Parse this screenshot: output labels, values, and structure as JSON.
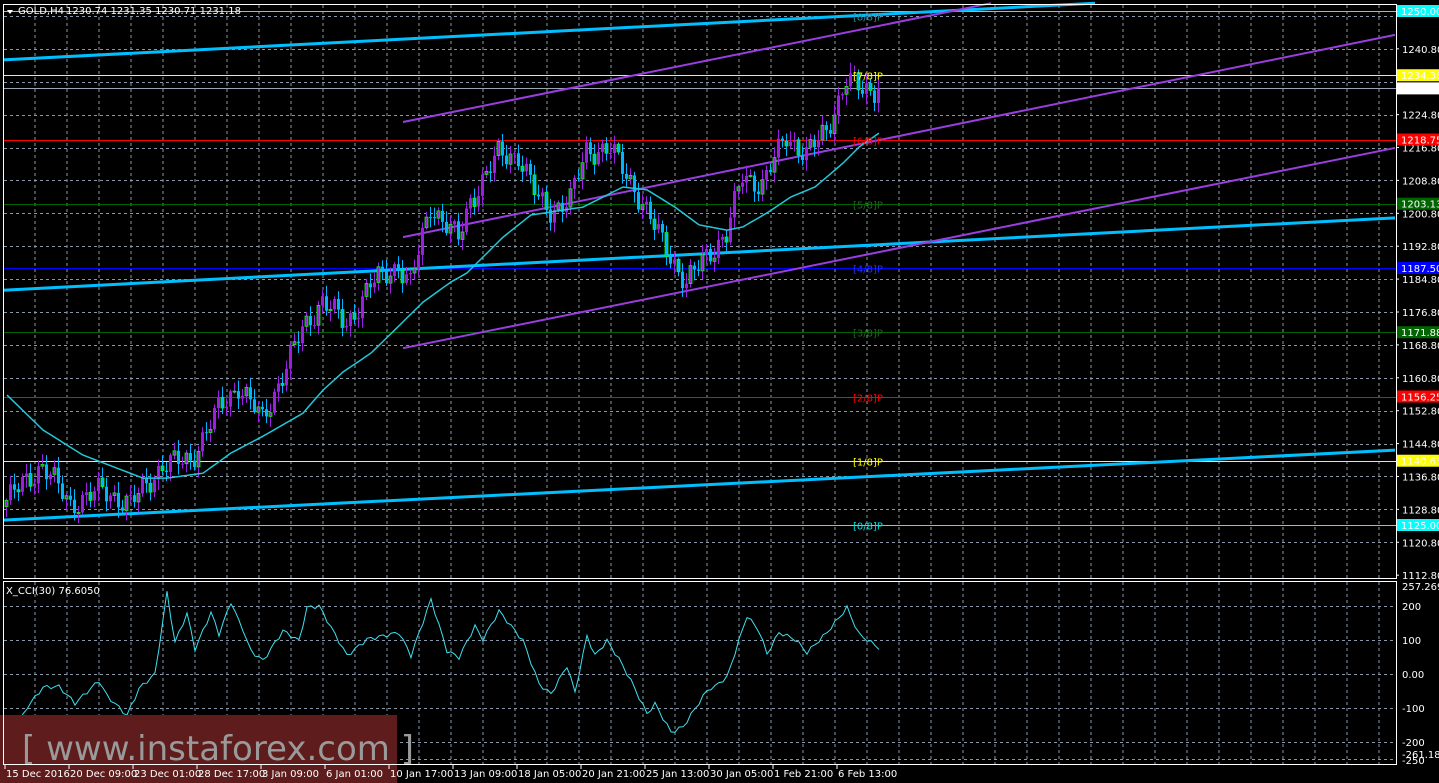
{
  "header": {
    "symbol": "GOLD,H4",
    "ohlc": "1230.74 1231.35 1230.71 1231.18"
  },
  "indicator": {
    "label": "X_CCI(30) 76.6050"
  },
  "watermark": {
    "text": "[ www.instaforex.com ]"
  },
  "colors": {
    "bull": "#9b1fe0",
    "bear": "#00b4ff",
    "bear_edge": "#00ff00",
    "ma": "#22c8d8",
    "cci": "#3de0f0",
    "trend": "#00bfff",
    "channel": "#9a3ee0"
  },
  "chart_data": {
    "type": "candlestick",
    "title": "GOLD,H4",
    "ylim": [
      1112.8,
      1252.5
    ],
    "x_tick_labels": [
      "15 Dec 2016",
      "20 Dec 09:00",
      "23 Dec 01:00",
      "28 Dec 17:00",
      "3 Jan 09:00",
      "6 Jan 01:00",
      "10 Jan 17:00",
      "13 Jan 09:00",
      "18 Jan 05:00",
      "20 Jan 21:00",
      "25 Jan 13:00",
      "30 Jan 05:00",
      "1 Feb 21:00",
      "6 Feb 13:00"
    ],
    "bars_per_x_tick": 16,
    "y_tick_labels": [
      "1240.80",
      "1224.80",
      "1216.80",
      "1208.80",
      "1200.80",
      "1192.80",
      "1184.80",
      "1176.80",
      "1168.80",
      "1160.80",
      "1152.80",
      "1144.80",
      "1136.80",
      "1128.80",
      "1120.80",
      "1112.80"
    ],
    "close_anchors": [
      [
        0,
        1131
      ],
      [
        9,
        1139.6
      ],
      [
        16,
        1130
      ],
      [
        24,
        1133.5
      ],
      [
        31,
        1130
      ],
      [
        39,
        1139.6
      ],
      [
        46,
        1140.8
      ],
      [
        53,
        1153
      ],
      [
        58,
        1159
      ],
      [
        64,
        1150.5
      ],
      [
        69,
        1161.5
      ],
      [
        74,
        1172.4
      ],
      [
        79,
        1179.7
      ],
      [
        85,
        1173.6
      ],
      [
        91,
        1183.4
      ],
      [
        98,
        1188.2
      ],
      [
        101,
        1183.4
      ],
      [
        106,
        1202.8
      ],
      [
        113,
        1194.3
      ],
      [
        116,
        1204
      ],
      [
        123,
        1215
      ],
      [
        128,
        1215
      ],
      [
        133,
        1204
      ],
      [
        136,
        1201.6
      ],
      [
        141,
        1204
      ],
      [
        145,
        1216.2
      ],
      [
        151,
        1216.2
      ],
      [
        156,
        1208.9
      ],
      [
        161,
        1199.2
      ],
      [
        166,
        1190.7
      ],
      [
        170,
        1183.4
      ],
      [
        175,
        1190.7
      ],
      [
        180,
        1195.5
      ],
      [
        184,
        1210
      ],
      [
        189,
        1207.7
      ],
      [
        195,
        1219.8
      ],
      [
        200,
        1215
      ],
      [
        205,
        1221
      ],
      [
        210,
        1233.2
      ],
      [
        214,
        1230.8
      ],
      [
        218,
        1231.18
      ]
    ],
    "ma_anchors": [
      [
        0,
        1156.6
      ],
      [
        9,
        1148.1
      ],
      [
        19,
        1142.0
      ],
      [
        34,
        1136.4
      ],
      [
        40,
        1136.4
      ],
      [
        49,
        1137.6
      ],
      [
        56,
        1142.5
      ],
      [
        64,
        1146.6
      ],
      [
        74,
        1152.2
      ],
      [
        79,
        1157.8
      ],
      [
        84,
        1162.2
      ],
      [
        91,
        1166.8
      ],
      [
        99,
        1174.4
      ],
      [
        104,
        1179.2
      ],
      [
        111,
        1184.1
      ],
      [
        115,
        1186.3
      ],
      [
        124,
        1195.0
      ],
      [
        131,
        1200.4
      ],
      [
        144,
        1202.3
      ],
      [
        154,
        1207.2
      ],
      [
        160,
        1206.5
      ],
      [
        167,
        1202.3
      ],
      [
        173,
        1198.0
      ],
      [
        180,
        1196.7
      ],
      [
        184,
        1197.5
      ],
      [
        190,
        1200.9
      ],
      [
        196,
        1204.8
      ],
      [
        202,
        1207.2
      ],
      [
        209,
        1213.0
      ],
      [
        213,
        1216.9
      ],
      [
        218,
        1220.3
      ]
    ],
    "murrey_levels": [
      {
        "label": "[8/8]P",
        "price": 1250.0,
        "price_text": "1250.00",
        "color": "#00ffff",
        "text_color": "#2a8fa0"
      },
      {
        "label": "[7/8]P",
        "price": 1234.38,
        "price_text": "1234.38",
        "color": "#ffff00",
        "text_color": "#ffff00"
      },
      {
        "label": "[6/8]P",
        "price": 1218.75,
        "price_text": "1218.75",
        "color": "#ff0000",
        "text_color": "#ff0000"
      },
      {
        "label": "[5/8]P",
        "price": 1203.13,
        "price_text": "1203.13",
        "color": "#006400",
        "text_color": "#1a6a1a"
      },
      {
        "label": "[4/8]P",
        "price": 1187.5,
        "price_text": "1187.50",
        "color": "#0000ff",
        "text_color": "#2030ff"
      },
      {
        "label": "[3/8]P",
        "price": 1171.88,
        "price_text": "1171.88",
        "color": "#006400",
        "text_color": "#1a6a1a"
      },
      {
        "label": "[2/8]P",
        "price": 1156.25,
        "price_text": "1156.25",
        "color": "#ff0000",
        "text_color": "#ff0000"
      },
      {
        "label": "[1/8]P",
        "price": 1140.63,
        "price_text": "1140.63",
        "color": "#ffff00",
        "text_color": "#ffff00"
      },
      {
        "label": "[0/8]P",
        "price": 1125.0,
        "price_text": "1125.00",
        "color": "#00ffff",
        "text_color": "#00e0e0"
      }
    ],
    "current_price": {
      "price": 1231.18,
      "price_text": "1231.18"
    },
    "trendlines": [
      {
        "kind": "trend",
        "from": [
          -1,
          1238.1
        ],
        "to": [
          272,
          1251.9
        ]
      },
      {
        "kind": "trend",
        "from": [
          -1,
          1182.1
        ],
        "to": [
          347,
          1199.7
        ]
      },
      {
        "kind": "trend",
        "from": [
          -1,
          1126.2
        ],
        "to": [
          347,
          1143.2
        ]
      },
      {
        "kind": "channel",
        "from": [
          99,
          1223.0
        ],
        "to": [
          246,
          1251.9
        ]
      },
      {
        "kind": "channel",
        "from": [
          99,
          1195.0
        ],
        "to": [
          347,
          1244.2
        ]
      },
      {
        "kind": "channel",
        "from": [
          99,
          1168.0
        ],
        "to": [
          347,
          1216.7
        ]
      }
    ],
    "cci": {
      "period": 30,
      "y_tick_labels": [
        "257.2693",
        "200",
        "100",
        "0.00",
        "-100",
        "-200",
        "-261.1837",
        "-250"
      ],
      "ylim": [
        -261.1837,
        257.2693
      ],
      "anchors": [
        [
          0,
          -219
        ],
        [
          5,
          -98
        ],
        [
          9,
          -39
        ],
        [
          13,
          -37
        ],
        [
          17,
          -86
        ],
        [
          23,
          -20
        ],
        [
          25,
          -64
        ],
        [
          30,
          -122
        ],
        [
          33,
          -43
        ],
        [
          37,
          0
        ],
        [
          40,
          239
        ],
        [
          42,
          93
        ],
        [
          45,
          178
        ],
        [
          47,
          73
        ],
        [
          51,
          181
        ],
        [
          53,
          117
        ],
        [
          56,
          212
        ],
        [
          61,
          68
        ],
        [
          64,
          39
        ],
        [
          69,
          127
        ],
        [
          73,
          98
        ],
        [
          75,
          195
        ],
        [
          78,
          200
        ],
        [
          85,
          54
        ],
        [
          90,
          102
        ],
        [
          98,
          122
        ],
        [
          101,
          54
        ],
        [
          106,
          219
        ],
        [
          110,
          68
        ],
        [
          113,
          49
        ],
        [
          117,
          141
        ],
        [
          119,
          102
        ],
        [
          123,
          185
        ],
        [
          129,
          98
        ],
        [
          133,
          -29
        ],
        [
          136,
          -59
        ],
        [
          140,
          24
        ],
        [
          142,
          -54
        ],
        [
          145,
          112
        ],
        [
          147,
          54
        ],
        [
          150,
          98
        ],
        [
          153,
          44
        ],
        [
          156,
          -20
        ],
        [
          160,
          -117
        ],
        [
          162,
          -88
        ],
        [
          166,
          -171
        ],
        [
          169,
          -156
        ],
        [
          175,
          -49
        ],
        [
          180,
          -10
        ],
        [
          185,
          171
        ],
        [
          188,
          127
        ],
        [
          190,
          59
        ],
        [
          193,
          122
        ],
        [
          197,
          102
        ],
        [
          200,
          63
        ],
        [
          205,
          122
        ],
        [
          210,
          195
        ],
        [
          213,
          117
        ],
        [
          218,
          76.6
        ]
      ]
    }
  }
}
